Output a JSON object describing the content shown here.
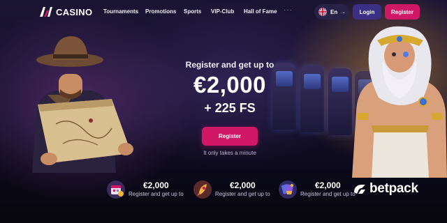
{
  "header": {
    "logo_text": "CASINO",
    "nav": [
      "Tournaments",
      "Promotions",
      "Sports",
      "VIP-Club",
      "Hall of Fame"
    ],
    "more": "···",
    "language": "En",
    "login_label": "Login",
    "register_label": "Register"
  },
  "hero": {
    "subtitle": "Register and get up to",
    "amount": "€2,000",
    "free_spins": "+ 225 FS",
    "cta_label": "Register",
    "cta_note": "It only takes a minute"
  },
  "bonuses": [
    {
      "amount": "€2,000",
      "label": "Register and get up to",
      "icon": "calendar-gift-icon"
    },
    {
      "amount": "€2,000",
      "label": "Register and get up to",
      "icon": "rocket-icon"
    },
    {
      "amount": "€2,000",
      "label": "Register and get up to",
      "icon": "trophy-cards-icon"
    }
  ],
  "watermark": "betpack",
  "colors": {
    "accent_pink": "#d01866",
    "login_purple": "#3c2f86",
    "background": "#0e0b1f"
  }
}
